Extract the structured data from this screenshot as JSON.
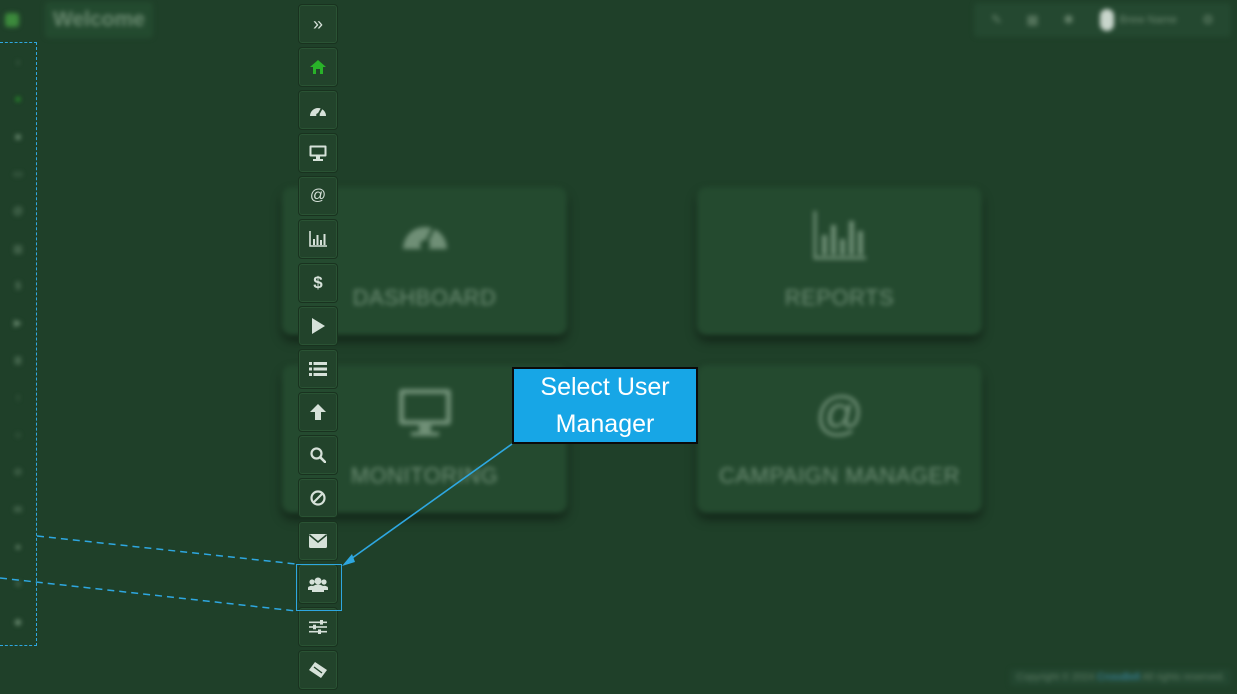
{
  "header": {
    "title": "Welcome",
    "user_name": "Brew Name",
    "icons": [
      "pencil-icon",
      "grid-icon",
      "wrench-icon",
      "gear-icon"
    ]
  },
  "left_strip": {
    "icons": [
      "chevron-icon",
      "home-icon",
      "dashboard-icon",
      "monitor-icon",
      "at-icon",
      "chart-icon",
      "dollar-icon",
      "play-icon",
      "list-icon",
      "upload-icon",
      "search-icon",
      "block-icon",
      "mail-icon",
      "users-icon",
      "sliders-icon",
      "ticket-icon"
    ]
  },
  "sidebar": {
    "buttons": [
      {
        "name": "expand",
        "glyph": "»"
      },
      {
        "name": "home",
        "glyph": "home"
      },
      {
        "name": "dashboard",
        "glyph": "gauge"
      },
      {
        "name": "monitoring",
        "glyph": "monitor"
      },
      {
        "name": "campaign-manager",
        "glyph": "@"
      },
      {
        "name": "reports",
        "glyph": "chart"
      },
      {
        "name": "billing",
        "glyph": "$"
      },
      {
        "name": "play",
        "glyph": "▶"
      },
      {
        "name": "list",
        "glyph": "list"
      },
      {
        "name": "upload",
        "glyph": "arrow-up"
      },
      {
        "name": "search",
        "glyph": "search"
      },
      {
        "name": "block",
        "glyph": "⊘"
      },
      {
        "name": "mail",
        "glyph": "mail"
      },
      {
        "name": "user-manager",
        "glyph": "users"
      },
      {
        "name": "settings",
        "glyph": "sliders"
      },
      {
        "name": "ticket",
        "glyph": "ticket"
      }
    ]
  },
  "cards": [
    {
      "label": "DASHBOARD",
      "icon": "gauge-icon"
    },
    {
      "label": "REPORTS",
      "icon": "chart-icon"
    },
    {
      "label": "MONITORING",
      "icon": "monitor-icon"
    },
    {
      "label": "CAMPAIGN MANAGER",
      "icon": "at-icon",
      "glyph": "@"
    }
  ],
  "footer": {
    "prefix": "Copyright © 2024",
    "brand": "CrossBell",
    "suffix": "All rights reserved."
  },
  "callout": {
    "line1": "Select User",
    "line2": "Manager"
  },
  "colors": {
    "background": "#1f4029",
    "accent": "#2ea7e0",
    "active_green": "#29b229",
    "callout_fill": "#17a6e6"
  }
}
